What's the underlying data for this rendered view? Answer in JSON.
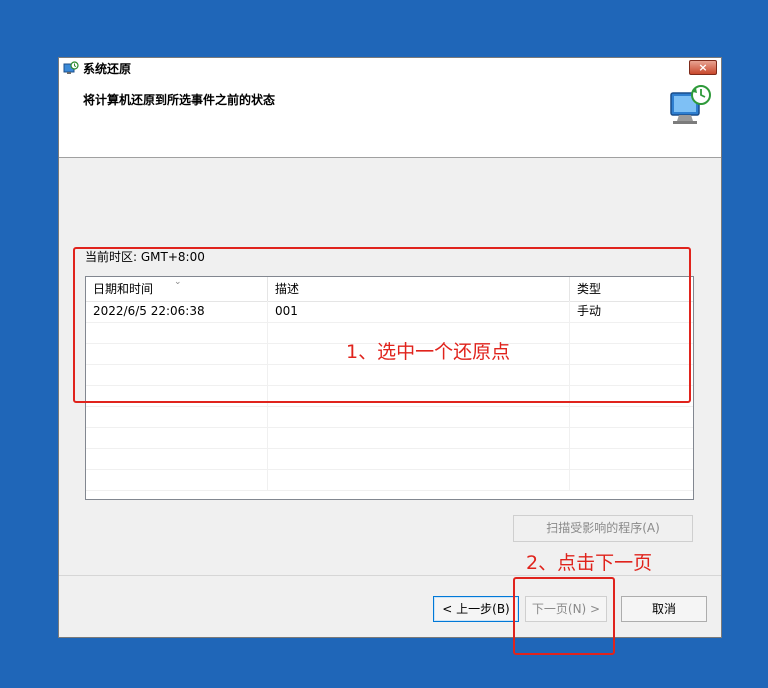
{
  "window": {
    "title": "系统还原",
    "close_glyph": "×",
    "header_title": "将计算机还原到所选事件之前的状态",
    "header_icon": "system-restore-monitor-icon"
  },
  "restore": {
    "timezone_label": "当前时区: GMT+8:00",
    "columns": [
      "日期和时间",
      "描述",
      "类型"
    ],
    "sort_glyph": "⌄",
    "rows": [
      {
        "datetime": "2022/6/5 22:06:38",
        "description": "001",
        "type": "手动"
      }
    ]
  },
  "buttons": {
    "scan": "扫描受影响的程序(A)",
    "back": "< 上一步(B)",
    "next": "下一页(N) >",
    "cancel": "取消"
  },
  "annotations": {
    "step1": "1、选中一个还原点",
    "step2": "2、点击下一页",
    "color": "#e0231c"
  },
  "colors": {
    "desktop": "#1f66b8",
    "window_bg": "#f0f0f0",
    "focus_border": "#0078d7"
  }
}
